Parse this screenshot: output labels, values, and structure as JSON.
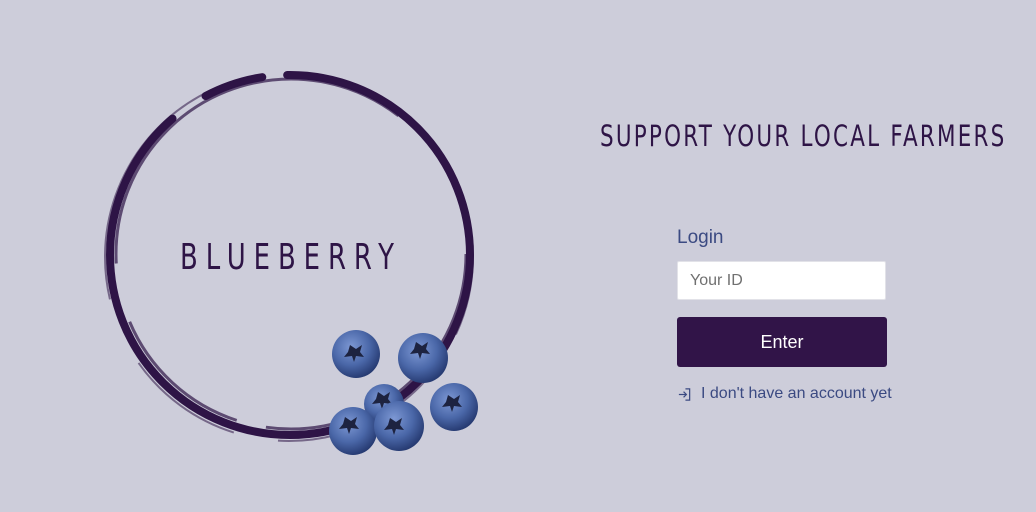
{
  "brand": {
    "name": "BLUEBERRY",
    "tagline": "SUPPORT YOUR LOCAL FARMERS"
  },
  "login": {
    "label": "Login",
    "id_placeholder": "Your ID",
    "id_value": "",
    "enter_label": "Enter",
    "signup_link": "I don't have an account yet",
    "signup_icon": "sign-in-icon"
  },
  "colors": {
    "background": "#cdcdda",
    "brand_purple": "#2e1446",
    "button": "#311448",
    "link_blue": "#3b4a82",
    "blueberry": "#4a67a8"
  }
}
